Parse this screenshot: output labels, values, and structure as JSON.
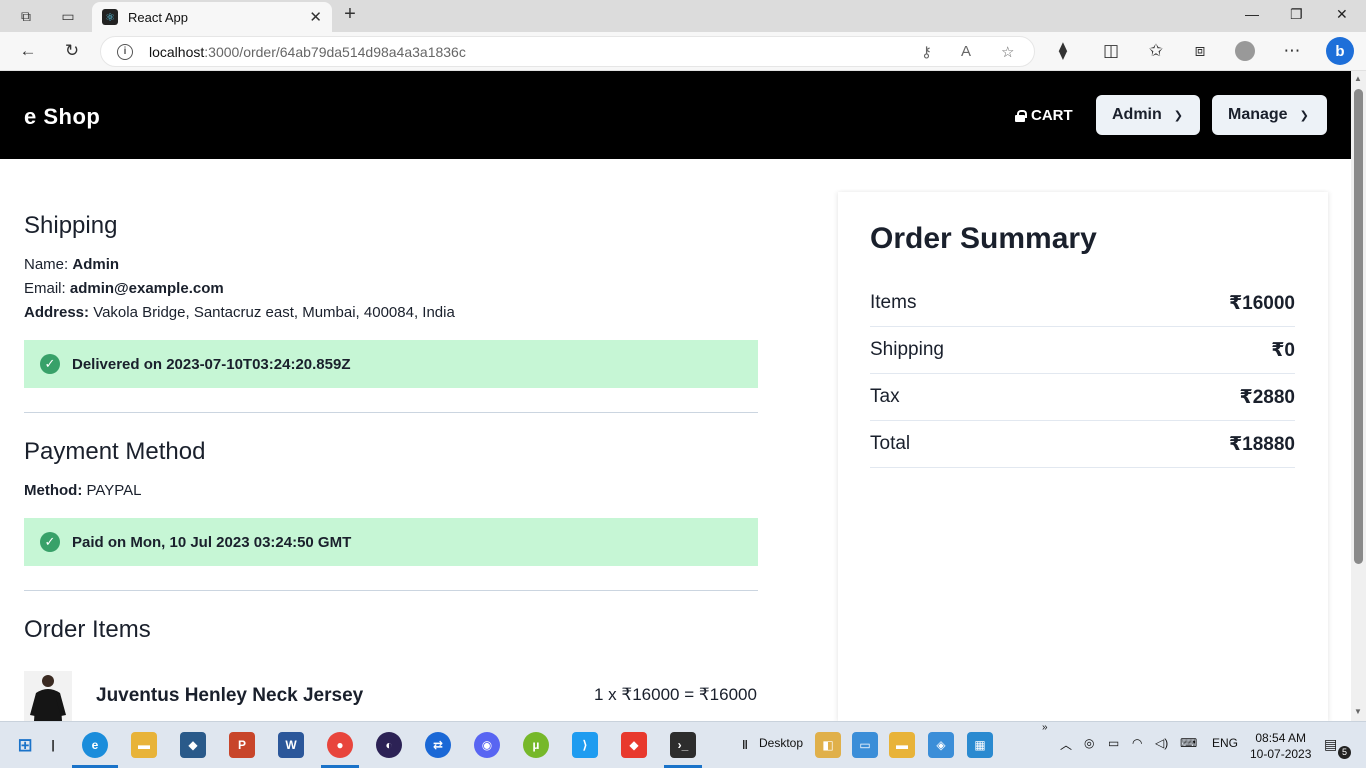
{
  "browser": {
    "tab_title": "React App",
    "url_host": "localhost",
    "url_path": ":3000/order/64ab79da514d98a4a3a1836c"
  },
  "header": {
    "brand": "e Shop",
    "cart_label": "CART",
    "admin_label": "Admin",
    "manage_label": "Manage"
  },
  "shipping": {
    "heading": "Shipping",
    "name_label": "Name:",
    "name": "Admin",
    "email_label": "Email:",
    "email": "admin@example.com",
    "address_label": "Address:",
    "address": "Vakola Bridge, Santacruz east, Mumbai, 400084, India",
    "status": "Delivered on 2023-07-10T03:24:20.859Z"
  },
  "payment": {
    "heading": "Payment Method",
    "method_label": "Method:",
    "method": "PAYPAL",
    "status": "Paid on Mon, 10 Jul 2023 03:24:50 GMT"
  },
  "order_items": {
    "heading": "Order Items",
    "items": [
      {
        "name": "Juventus Henley Neck Jersey",
        "price_line": "1 x ₹16000 = ₹16000"
      }
    ]
  },
  "summary": {
    "heading": "Order Summary",
    "rows": [
      {
        "label": "Items",
        "value": "₹16000"
      },
      {
        "label": "Shipping",
        "value": "₹0"
      },
      {
        "label": "Tax",
        "value": "₹2880"
      },
      {
        "label": "Total",
        "value": "₹18880"
      }
    ]
  },
  "taskbar": {
    "desktop_label": "Desktop",
    "lang": "ENG",
    "time": "08:54 AM",
    "date": "10-07-2023",
    "notification_count": "5"
  },
  "colors": {
    "success_bg": "#c6f6d5",
    "success_icon": "#38a169",
    "header_bg": "#000000",
    "menu_btn_bg": "#edf2f7"
  }
}
